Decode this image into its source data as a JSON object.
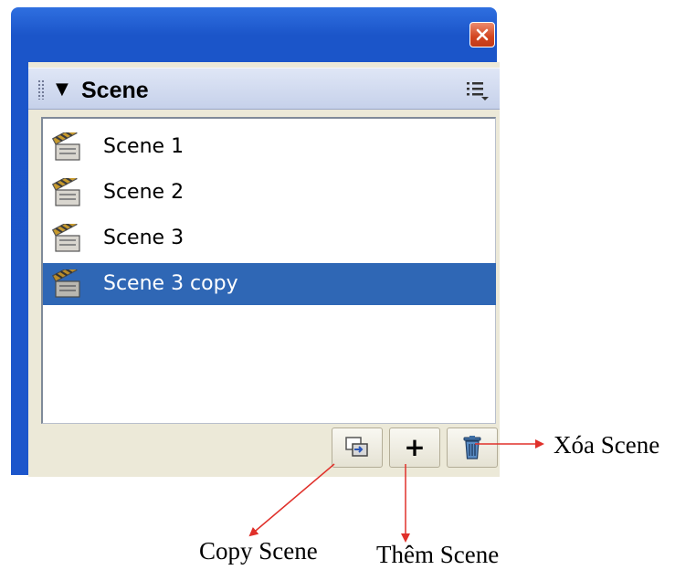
{
  "panel": {
    "title": "Scene",
    "icons": {
      "close": "close-icon",
      "collapse": "triangle-down-icon",
      "grip": "grip-icon",
      "options": "panel-menu-icon",
      "scene": "clapperboard-icon"
    },
    "scenes": [
      {
        "label": "Scene 1",
        "selected": false
      },
      {
        "label": "Scene 2",
        "selected": false
      },
      {
        "label": "Scene 3",
        "selected": false
      },
      {
        "label": "Scene 3 copy",
        "selected": true
      }
    ],
    "toolbar": {
      "duplicate_icon": "duplicate-scene-icon",
      "add_label": "+",
      "delete_icon": "trash-icon"
    }
  },
  "annotations": {
    "delete": "Xóa Scene",
    "copy": "Copy Scene",
    "add": "Thêm Scene"
  },
  "colors": {
    "window_frame": "#1c56cb",
    "selection": "#2f67b5",
    "close_button": "#d2451f",
    "arrow": "#e0302a"
  }
}
